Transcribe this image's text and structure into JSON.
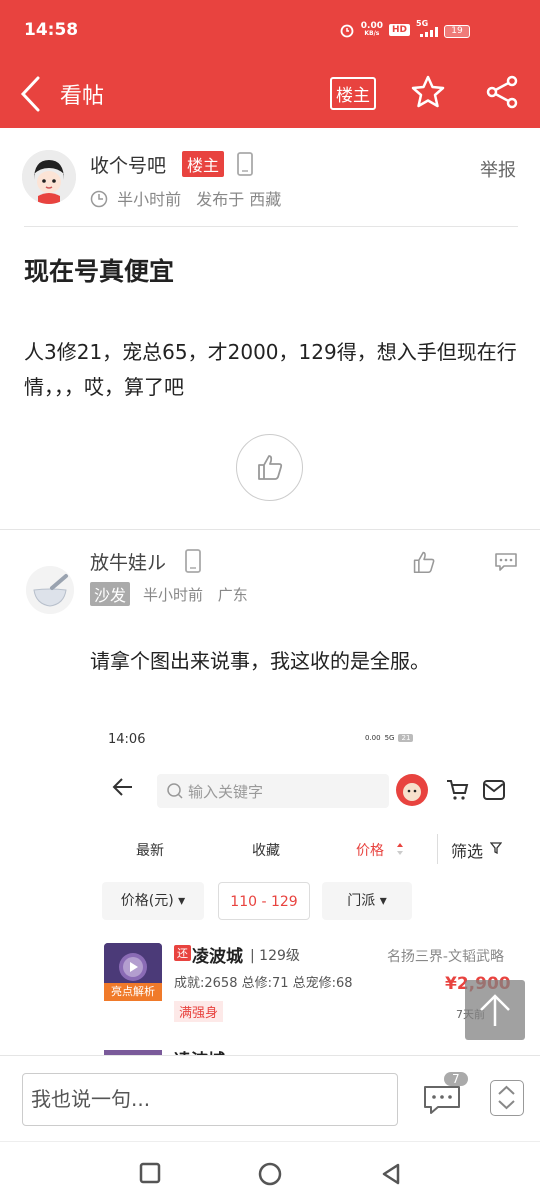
{
  "status_bar": {
    "time": "14:58",
    "net_speed": "0.00",
    "net_unit": "KB/s",
    "hd": "HD",
    "signal": "5G",
    "battery": "19"
  },
  "app_bar": {
    "title": "看帖",
    "host_only_label": "楼主"
  },
  "post": {
    "author_name": "收个号吧",
    "author_badge": "楼主",
    "time": "半小时前",
    "location": "发布于 西藏",
    "report_label": "举报",
    "title": "现在号真便宜",
    "body": "人3修21，宠总65，才2000，129得，想入手但现在行情，，，哎，算了吧"
  },
  "reply": {
    "name": "放牛娃ル",
    "floor": "沙发",
    "time": "半小时前",
    "location": "广东",
    "text": "请拿个图出来说事，我这收的是全服。",
    "screenshot": {
      "time": "14:06",
      "status_text": "0.00",
      "signal": "5G",
      "battery": "21",
      "search_placeholder": "输入关键字",
      "tabs": [
        "最新",
        "收藏",
        "价格",
        "筛选"
      ],
      "filters": [
        "价格(元)",
        "110 - 129",
        "门派"
      ],
      "item": {
        "tag": "还",
        "name": "凌波城",
        "level": "| 129级",
        "server": "名扬三界-文韬武略",
        "stats": "成就:2658 总修:71 总宠修:68",
        "price": "¥2,900",
        "badge": "满强身",
        "thumb_tag": "亮点解析",
        "days": "7天前"
      },
      "item2_name": "凌波城"
    }
  },
  "comment_bar": {
    "placeholder": "我也说一句...",
    "count": "7"
  },
  "colors": {
    "brand_red": "#e8433f",
    "gray_text": "#888888"
  }
}
